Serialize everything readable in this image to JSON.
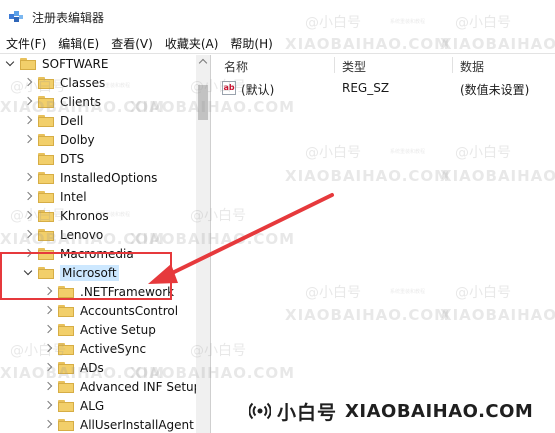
{
  "window": {
    "title": "注册表编辑器"
  },
  "menu": [
    "文件(F)",
    "编辑(E)",
    "查看(V)",
    "收藏夹(A)",
    "帮助(H)"
  ],
  "tree": {
    "items": [
      {
        "label": "SOFTWARE",
        "state": "expanded",
        "level": 0
      },
      {
        "label": "Classes",
        "state": "collapsed",
        "level": 1
      },
      {
        "label": "Clients",
        "state": "collapsed",
        "level": 1
      },
      {
        "label": "Dell",
        "state": "collapsed",
        "level": 1
      },
      {
        "label": "Dolby",
        "state": "collapsed",
        "level": 1
      },
      {
        "label": "DTS",
        "state": "leaf",
        "level": 1
      },
      {
        "label": "InstalledOptions",
        "state": "collapsed",
        "level": 1
      },
      {
        "label": "Intel",
        "state": "collapsed",
        "level": 1
      },
      {
        "label": "Khronos",
        "state": "collapsed",
        "level": 1
      },
      {
        "label": "Lenovo",
        "state": "collapsed",
        "level": 1
      },
      {
        "label": "Macromedia",
        "state": "collapsed",
        "level": 1
      },
      {
        "label": "Microsoft",
        "state": "expanded",
        "level": 1,
        "selected": true
      },
      {
        "label": ".NETFramework",
        "state": "collapsed",
        "level": 2
      },
      {
        "label": "AccountsControl",
        "state": "collapsed",
        "level": 2
      },
      {
        "label": "Active Setup",
        "state": "collapsed",
        "level": 2
      },
      {
        "label": "ActiveSync",
        "state": "collapsed",
        "level": 2
      },
      {
        "label": "ADs",
        "state": "collapsed",
        "level": 2
      },
      {
        "label": "Advanced INF Setup",
        "state": "collapsed",
        "level": 2
      },
      {
        "label": "ALG",
        "state": "collapsed",
        "level": 2
      },
      {
        "label": "AllUserInstallAgent",
        "state": "collapsed",
        "level": 2
      }
    ]
  },
  "values_pane": {
    "columns": [
      "名称",
      "类型",
      "数据"
    ],
    "rows": [
      {
        "icon": "ab",
        "name": "(默认)",
        "type": "REG_SZ",
        "data": "(数值未设置)"
      }
    ]
  },
  "watermark": {
    "cn": "@小白号",
    "en": "XIAOBAIHAO.COM",
    "small": "系统重装和教程"
  },
  "branding": {
    "cn": "小白号",
    "en": "XIAOBAIHAO.COM"
  },
  "colors": {
    "highlight": "#e6393c",
    "selection": "#cde8ff",
    "folder": "#f2cf6a"
  }
}
